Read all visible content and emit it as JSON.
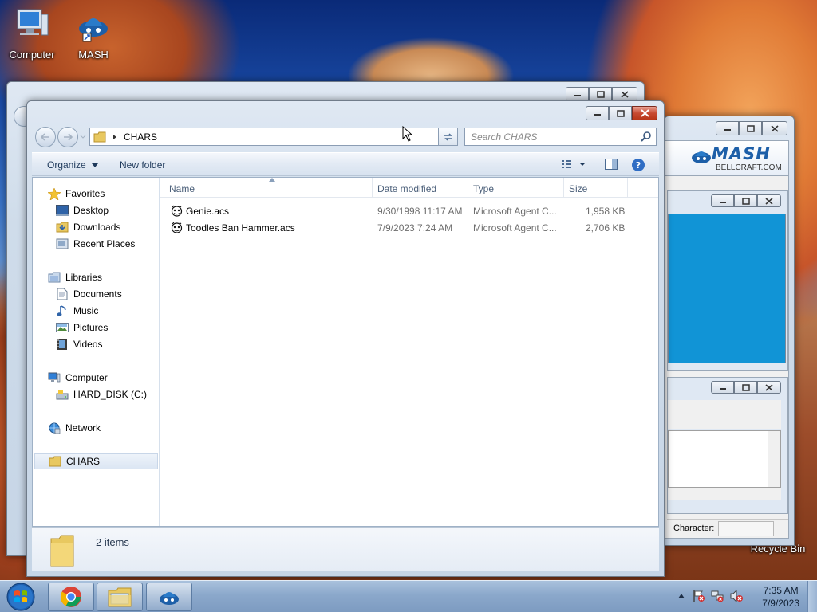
{
  "desktop": {
    "icons": [
      {
        "label": "Computer",
        "icon": "computer-icon"
      },
      {
        "label": "MASH",
        "icon": "mash-icon"
      },
      {
        "label": "Recycle Bin",
        "icon": "recycle-bin-icon"
      }
    ]
  },
  "explorer": {
    "address": {
      "segment": "CHARS"
    },
    "search": {
      "placeholder": "Search CHARS"
    },
    "toolbar": {
      "organize": "Organize",
      "new_folder": "New folder"
    },
    "nav": {
      "favorites": "Favorites",
      "desktop": "Desktop",
      "downloads": "Downloads",
      "recent_places": "Recent Places",
      "libraries": "Libraries",
      "documents": "Documents",
      "music": "Music",
      "pictures": "Pictures",
      "videos": "Videos",
      "computer": "Computer",
      "hard_disk": "HARD_DISK (C:)",
      "network": "Network",
      "chars": "CHARS"
    },
    "columns": {
      "name": "Name",
      "date_modified": "Date modified",
      "type": "Type",
      "size": "Size"
    },
    "files": [
      {
        "name": "Genie.acs",
        "date": "9/30/1998 11:17 AM",
        "type": "Microsoft Agent C...",
        "size": "1,958 KB"
      },
      {
        "name": "Toodles Ban Hammer.acs",
        "date": "7/9/2023 7:24 AM",
        "type": "Microsoft Agent C...",
        "size": "2,706 KB"
      }
    ],
    "details": {
      "count": "2 items"
    }
  },
  "mash": {
    "logo": "MASH",
    "site": "BELLCRAFT.COM",
    "character_label": "Character:"
  },
  "taskbar": {
    "time": "7:35 AM",
    "date": "7/9/2023"
  },
  "colors": {
    "mash_panel": "#1194d6",
    "window_frame": "#c6d5e6",
    "close_button": "#c74a32"
  }
}
